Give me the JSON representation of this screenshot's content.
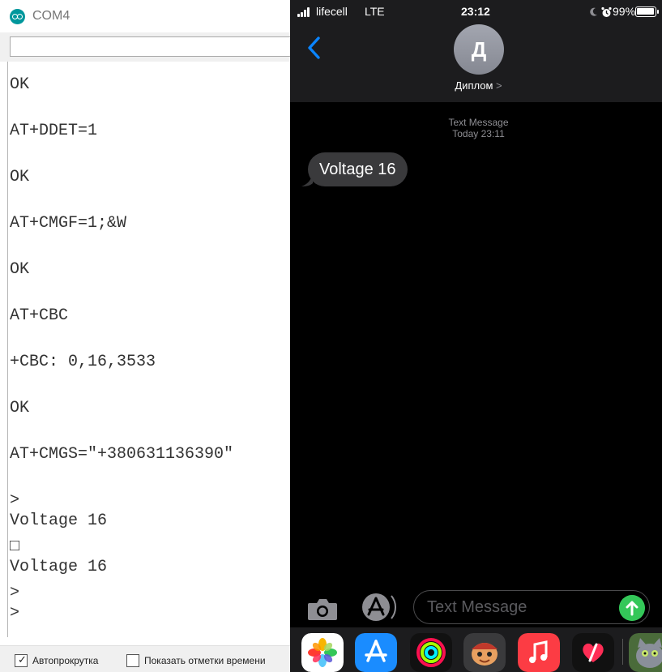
{
  "serial_monitor": {
    "window_title": "COM4",
    "input_value": "",
    "output_lines": [
      "OK",
      "AT+DDET=1",
      "OK",
      "AT+CMGF=1;&W",
      "OK",
      "AT+CBC",
      "+CBC: 0,16,3533",
      "OK",
      "AT+CMGS=\"+380631136390\"",
      ">",
      "Voltage 16",
      "□",
      "Voltage 16",
      ">",
      ">"
    ],
    "autoscroll_label": "Автопрокрутка",
    "autoscroll_checked": true,
    "timestamps_label": "Показать отметки времени",
    "timestamps_checked": false
  },
  "phone": {
    "status_bar": {
      "carrier": "lifecell",
      "network": "LTE",
      "time": "23:12",
      "battery": "99%",
      "battery_level": 0.99
    },
    "contact": {
      "initial": "Д",
      "name": "Диплом",
      "chevron": ">"
    },
    "thread": {
      "service": "Text Message",
      "timestamp": "Today 23:11",
      "messages": [
        {
          "direction": "incoming",
          "text": "Voltage 16"
        }
      ]
    },
    "compose": {
      "placeholder": "Text Message",
      "value": ""
    },
    "app_tray": [
      "photos-icon",
      "app-store-icon",
      "activity-icon",
      "memoji-icon",
      "music-icon",
      "digital-touch-icon",
      "talking-tom-icon"
    ],
    "colors": {
      "accent_blue": "#0a84ff",
      "send_green": "#34c759",
      "bubble_gray": "#3a3a3c",
      "header_bg": "#1c1c1e"
    }
  }
}
